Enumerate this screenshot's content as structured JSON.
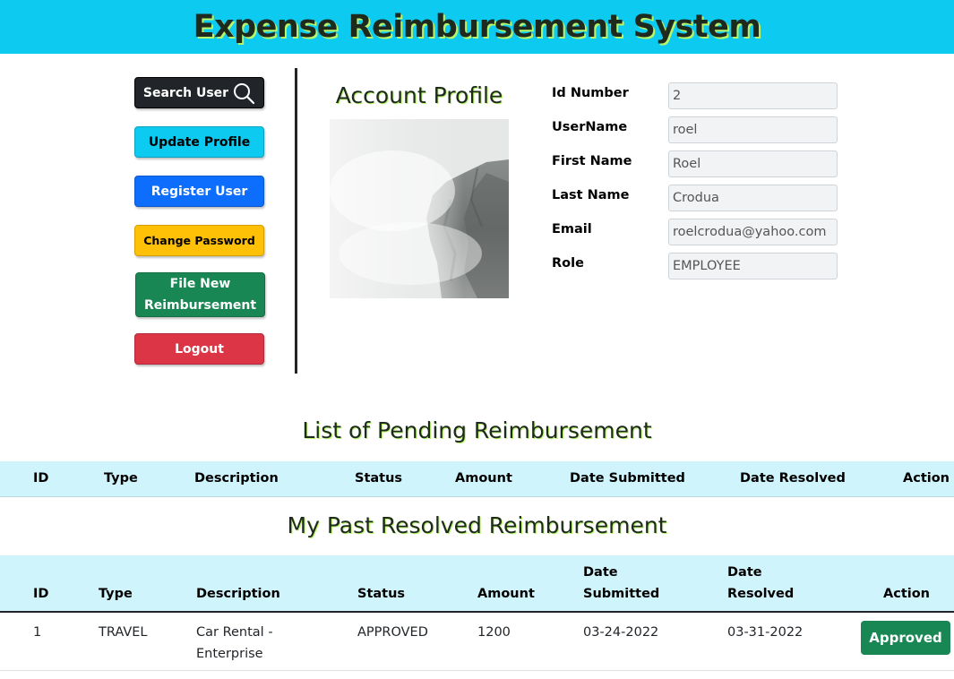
{
  "app": {
    "title": "Expense Reimbursement System"
  },
  "sidebar": {
    "search_label": "Search User",
    "update_label": "Update Profile",
    "register_label": "Register User",
    "password_label": "Change Password",
    "file_label_line1": "File New",
    "file_label_line2": "Reimbursement",
    "logout_label": "Logout"
  },
  "profile": {
    "title": "Account Profile",
    "fields": [
      {
        "label": "Id Number",
        "value": "2"
      },
      {
        "label": "UserName",
        "value": "roel"
      },
      {
        "label": "First Name",
        "value": "Roel"
      },
      {
        "label": "Last Name",
        "value": "Crodua"
      },
      {
        "label": "Email",
        "value": "roelcrodua@yahoo.com"
      },
      {
        "label": "Role",
        "value": "EMPLOYEE"
      }
    ]
  },
  "pending": {
    "title": "List of Pending Reimbursement",
    "headers": [
      "ID",
      "Type",
      "Description",
      "Status",
      "Amount",
      "Date Submitted",
      "Date Resolved",
      "Action"
    ]
  },
  "resolved": {
    "title": "My Past Resolved Reimbursement",
    "headers": {
      "id": "ID",
      "type": "Type",
      "description": "Description",
      "status": "Status",
      "amount": "Amount",
      "date_submitted_1": "Date",
      "date_submitted_2": "Submitted",
      "date_resolved_1": "Date",
      "date_resolved_2": "Resolved",
      "action": "Action"
    },
    "rows": [
      {
        "id": "1",
        "type": "TRAVEL",
        "description_1": "Car Rental -",
        "description_2": "Enterprise",
        "status": "APPROVED",
        "amount": "1200",
        "date_submitted": "03-24-2022",
        "date_resolved": "03-31-2022",
        "action": "Approved"
      }
    ]
  },
  "colors": {
    "header_bg": "#0dcaf0",
    "table_header_bg": "#cff4fc",
    "title_shadow": "#b7f56a",
    "success": "#198754",
    "primary": "#0d6efd",
    "warning": "#ffc107",
    "danger": "#dc3545",
    "dark": "#212529"
  }
}
